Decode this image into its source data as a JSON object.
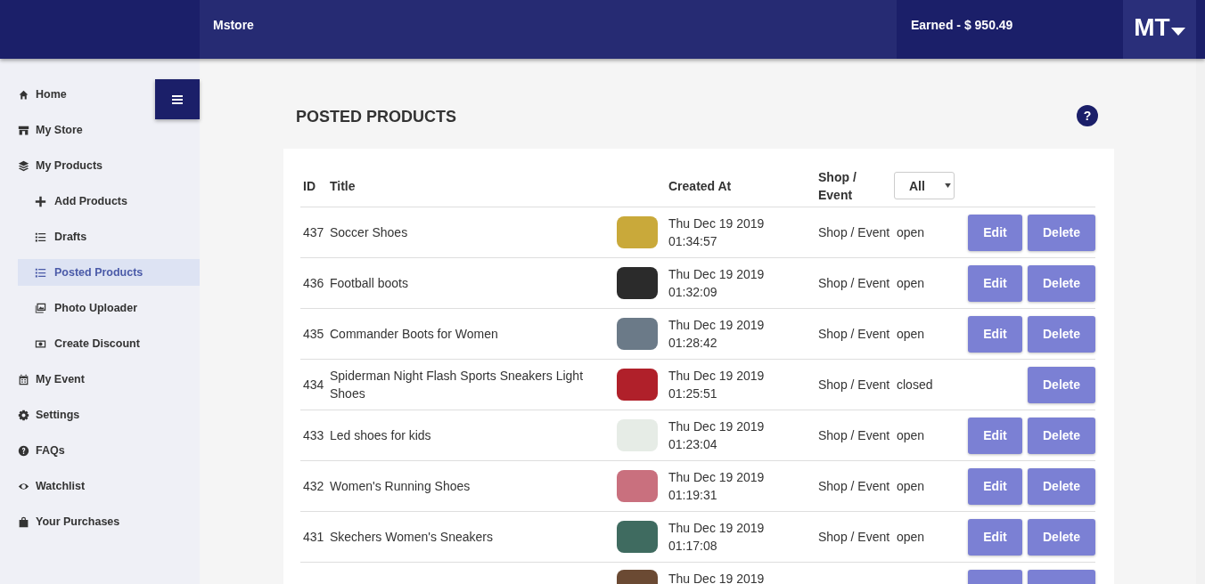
{
  "header": {
    "brand": "Mstore",
    "earned": "Earned - $ 950.49",
    "avatar": "MT"
  },
  "sidebar": {
    "items": [
      {
        "label": "Home",
        "selected": false
      },
      {
        "label": "My Store",
        "selected": false
      },
      {
        "label": "My Products",
        "selected": false,
        "children": [
          {
            "label": "Add Products",
            "selected": false
          },
          {
            "label": "Drafts",
            "selected": false
          },
          {
            "label": "Posted Products",
            "selected": true
          },
          {
            "label": "Photo Uploader",
            "selected": false
          },
          {
            "label": "Create Discount",
            "selected": false
          }
        ]
      },
      {
        "label": "My Event",
        "selected": false
      },
      {
        "label": "Settings",
        "selected": false
      },
      {
        "label": "FAQs",
        "selected": false
      },
      {
        "label": "Watchlist",
        "selected": false
      },
      {
        "label": "Your Purchases",
        "selected": false
      }
    ]
  },
  "page": {
    "title": "POSTED PRODUCTS",
    "help": "?"
  },
  "table": {
    "columns": [
      "ID",
      "Title",
      "Created At",
      "Shop / Event"
    ],
    "filter": "All",
    "rows": [
      {
        "id": "437",
        "title": "Soccer Shoes",
        "date": "Thu Dec 19 2019",
        "time": "01:34:57",
        "shop": "Shop / Event",
        "status": "open",
        "actions": [
          "Edit",
          "Delete"
        ]
      },
      {
        "id": "436",
        "title": "Football boots",
        "date": "Thu Dec 19 2019",
        "time": "01:32:09",
        "shop": "Shop / Event",
        "status": "open",
        "actions": [
          "Edit",
          "Delete"
        ]
      },
      {
        "id": "435",
        "title": "Commander Boots for Women",
        "date": "Thu Dec 19 2019",
        "time": "01:28:42",
        "shop": "Shop / Event",
        "status": "open",
        "actions": [
          "Edit",
          "Delete"
        ]
      },
      {
        "id": "434",
        "title": "Spiderman Night Flash Sports Sneakers Light Shoes",
        "date": "Thu Dec 19 2019",
        "time": "01:25:51",
        "shop": "Shop / Event",
        "status": "closed",
        "actions": [
          "Delete"
        ]
      },
      {
        "id": "433",
        "title": "Led shoes for kids",
        "date": "Thu Dec 19 2019",
        "time": "01:23:04",
        "shop": "Shop / Event",
        "status": "open",
        "actions": [
          "Edit",
          "Delete"
        ]
      },
      {
        "id": "432",
        "title": "Women's Running Shoes",
        "date": "Thu Dec 19 2019",
        "time": "01:19:31",
        "shop": "Shop / Event",
        "status": "open",
        "actions": [
          "Edit",
          "Delete"
        ]
      },
      {
        "id": "431",
        "title": "Skechers Women's Sneakers",
        "date": "Thu Dec 19 2019",
        "time": "01:17:08",
        "shop": "Shop / Event",
        "status": "open",
        "actions": [
          "Edit",
          "Delete"
        ]
      },
      {
        "date": "Thu Dec 19 2019"
      }
    ]
  }
}
